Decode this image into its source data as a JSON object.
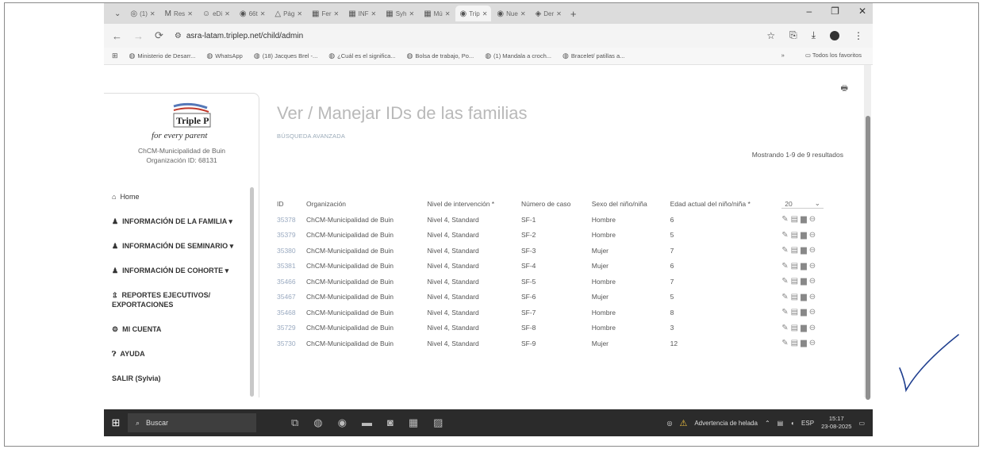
{
  "browser": {
    "tabs": [
      {
        "glyph": "◎",
        "label": "(1)"
      },
      {
        "glyph": "M",
        "label": "Res"
      },
      {
        "glyph": "☺",
        "label": "eDi"
      },
      {
        "glyph": "◉",
        "label": "66t"
      },
      {
        "glyph": "△",
        "label": "Pág"
      },
      {
        "glyph": "▦",
        "label": "Fer"
      },
      {
        "glyph": "▦",
        "label": "INF"
      },
      {
        "glyph": "▦",
        "label": "Syh"
      },
      {
        "glyph": "▦",
        "label": "Mú"
      },
      {
        "glyph": "◉",
        "label": "Trip"
      },
      {
        "glyph": "◉",
        "label": "Nue"
      },
      {
        "glyph": "◈",
        "label": "Der"
      }
    ],
    "url": "asra-latam.triplep.net/child/admin",
    "bookmarks": [
      "Ministerio de Desarr...",
      "WhatsApp",
      "(18) Jacques Brel -...",
      "¿Cuál es el significa...",
      "Bolsa de trabajo, Po...",
      "(1) Mandala a croch...",
      "Bracelet/ patillas a..."
    ],
    "bookmarks_more": "»",
    "all_favorites": "Todos los favoritos"
  },
  "sidebar": {
    "logo_text": "Triple P",
    "logo_tagline": "for every parent",
    "org_name": "ChCM-Municipalidad de Buin",
    "org_id": "Organización ID: 68131",
    "items": [
      {
        "icon": "home-icon",
        "label": "Home"
      },
      {
        "icon": "user-icon",
        "label": "INFORMACIÓN DE LA FAMILIA ▾"
      },
      {
        "icon": "user-icon",
        "label": "INFORMACIÓN DE SEMINARIO ▾"
      },
      {
        "icon": "user-icon",
        "label": "INFORMACIÓN DE COHORTE ▾"
      },
      {
        "icon": "report-icon",
        "label": "REPORTES EJECUTIVOS/ EXPORTACIONES"
      },
      {
        "icon": "gear-icon",
        "label": "MI CUENTA"
      },
      {
        "icon": "help-icon",
        "label": "AYUDA"
      },
      {
        "icon": "",
        "label": "SALIR (Sylvia)"
      }
    ]
  },
  "main": {
    "title": "Ver / Manejar IDs de las familias",
    "advanced_search": "BÚSQUEDA AVANZADA",
    "results_text": "Mostrando 1-9 de 9 resultados",
    "page_size": "20",
    "columns": [
      "ID",
      "Organización",
      "Nivel de intervención *",
      "Número de caso",
      "Sexo del niño/niña",
      "Edad actual del niño/niña *"
    ],
    "rows": [
      [
        "35378",
        "ChCM-Municipalidad de Buin",
        "Nivel 4, Standard",
        "SF-1",
        "Hombre",
        "6"
      ],
      [
        "35379",
        "ChCM-Municipalidad de Buin",
        "Nivel 4, Standard",
        "SF-2",
        "Hombre",
        "5"
      ],
      [
        "35380",
        "ChCM-Municipalidad de Buin",
        "Nivel 4, Standard",
        "SF-3",
        "Mujer",
        "7"
      ],
      [
        "35381",
        "ChCM-Municipalidad de Buin",
        "Nivel 4, Standard",
        "SF-4",
        "Mujer",
        "6"
      ],
      [
        "35466",
        "ChCM-Municipalidad de Buin",
        "Nivel 4, Standard",
        "SF-5",
        "Hombre",
        "7"
      ],
      [
        "35467",
        "ChCM-Municipalidad de Buin",
        "Nivel 4, Standard",
        "SF-6",
        "Mujer",
        "5"
      ],
      [
        "35468",
        "ChCM-Municipalidad de Buin",
        "Nivel 4, Standard",
        "SF-7",
        "Hombre",
        "8"
      ],
      [
        "35729",
        "ChCM-Municipalidad de Buin",
        "Nivel 4, Standard",
        "SF-8",
        "Hombre",
        "3"
      ],
      [
        "35730",
        "ChCM-Municipalidad de Buin",
        "Nivel 4, Standard",
        "SF-9",
        "Mujer",
        "12"
      ]
    ]
  },
  "taskbar": {
    "search_placeholder": "Buscar",
    "weather_alert": "Advertencia de helada",
    "language": "ESP",
    "time": "15:17",
    "date": "23-08-2025"
  },
  "colors": {
    "title": "#b9b9b9",
    "id_link": "#9aaac0",
    "taskbar": "#2b2b2b",
    "check_mark": "#1f3f8f"
  }
}
